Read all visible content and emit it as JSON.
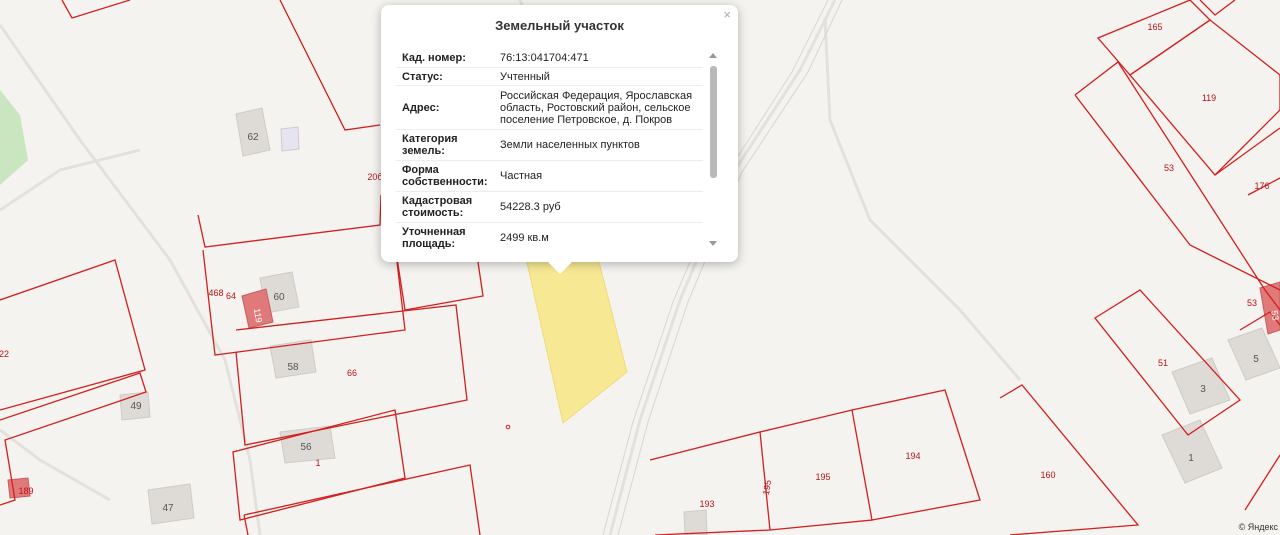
{
  "popup": {
    "title": "Земельный участок",
    "close": "×",
    "rows": [
      {
        "key": "Кад. номер:",
        "value": "76:13:041704:471"
      },
      {
        "key": "Статус:",
        "value": "Учтенный"
      },
      {
        "key": "Адрес:",
        "value": "Российская Федерация, Ярославская область, Ростовский район, сельское поселение Петровское, д. Покров"
      },
      {
        "key": "Категория земель:",
        "value": "Земли населенных пунктов"
      },
      {
        "key": "Форма собственности:",
        "value": "Частная"
      },
      {
        "key": "Кадастровая стоимость:",
        "value": "54228.3 руб"
      },
      {
        "key": "Уточненная площадь:",
        "value": "2499 кв.м"
      }
    ]
  },
  "map": {
    "colors": {
      "background": "#f4f3ef",
      "parcel_outline": "#d21f1f",
      "parcel_label": "#b8141a",
      "selected_parcel": "#f8e98a",
      "building": "#dedbd6",
      "building_red": "#e07a7a",
      "park": "#c9e6c0",
      "road": "#e3e1dc"
    },
    "parcel_labels": [
      "165",
      "119",
      "53",
      "176",
      "53",
      "51",
      "5",
      "3",
      "1",
      "160",
      "194",
      "195",
      "195",
      "193",
      "66",
      "1",
      "58",
      "56",
      "468",
      "64",
      "60",
      "119",
      "62",
      "20б",
      "22",
      "49",
      "189",
      "47"
    ],
    "attribution": "© Яндекс"
  }
}
